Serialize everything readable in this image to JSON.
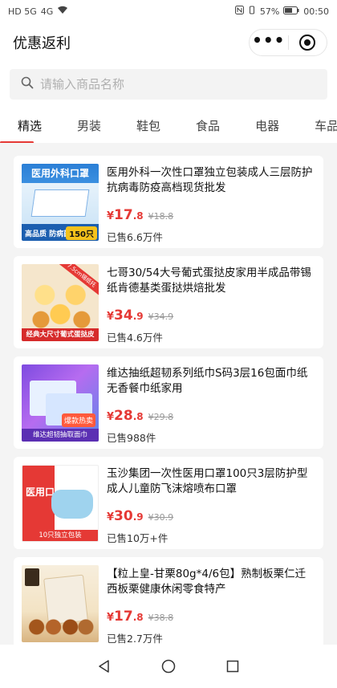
{
  "status_bar": {
    "network_left": "HD 5G",
    "network_right": "4G",
    "battery": "57%",
    "time": "00:50"
  },
  "header": {
    "title": "优惠返利"
  },
  "search": {
    "placeholder": "请输入商品名称"
  },
  "tabs": [
    {
      "label": "精选",
      "active": true
    },
    {
      "label": "男装",
      "active": false
    },
    {
      "label": "鞋包",
      "active": false
    },
    {
      "label": "食品",
      "active": false
    },
    {
      "label": "电器",
      "active": false
    },
    {
      "label": "车品",
      "active": false
    }
  ],
  "accent_color": "#e53935",
  "products": [
    {
      "title": "医用外科一次性口罩独立包装成人三层防护抗病毒防疫高档现货批发",
      "currency": "¥",
      "price_int": "17",
      "price_dec": ".8",
      "original_price": "¥18.8",
      "sold": "已售6.6万件",
      "thumb_text": {
        "head": "医用外科口罩",
        "foot": "高品质 防病菌",
        "tag": "150只"
      }
    },
    {
      "title": "七哥30/54大号葡式蛋挞皮家用半成品带锡纸肯德基类蛋挞烘焙批发",
      "currency": "¥",
      "price_int": "34",
      "price_dec": ".9",
      "original_price": "¥34.9",
      "sold": "已售4.6万件",
      "thumb_text": {
        "band": "经典大尺寸葡式蛋挞皮",
        "ribbon": "7.5cm锡纸托"
      }
    },
    {
      "title": "维达抽纸超韧系列纸巾S码3层16包面巾纸无香餐巾纸家用",
      "currency": "¥",
      "price_int": "28",
      "price_dec": ".8",
      "original_price": "¥29.8",
      "sold": "已售988件",
      "thumb_text": {
        "band": "维达超韧抽取面巾",
        "hot": "爆款热卖"
      }
    },
    {
      "title": "玉沙集团一次性医用口罩100只3层防护型成人儿童防飞沫熔喷布口罩",
      "currency": "¥",
      "price_int": "30",
      "price_dec": ".9",
      "original_price": "¥30.9",
      "sold": "已售10万+件",
      "thumb_text": {
        "side": "医用口罩",
        "band": "10只独立包装"
      }
    },
    {
      "title": "【粒上皇-甘栗80g*4/6包】熟制板栗仁迁西板栗健康休闲零食特产",
      "currency": "¥",
      "price_int": "17",
      "price_dec": ".8",
      "original_price": "¥38.8",
      "sold": "已售2.7万件",
      "thumb_text": {}
    }
  ]
}
